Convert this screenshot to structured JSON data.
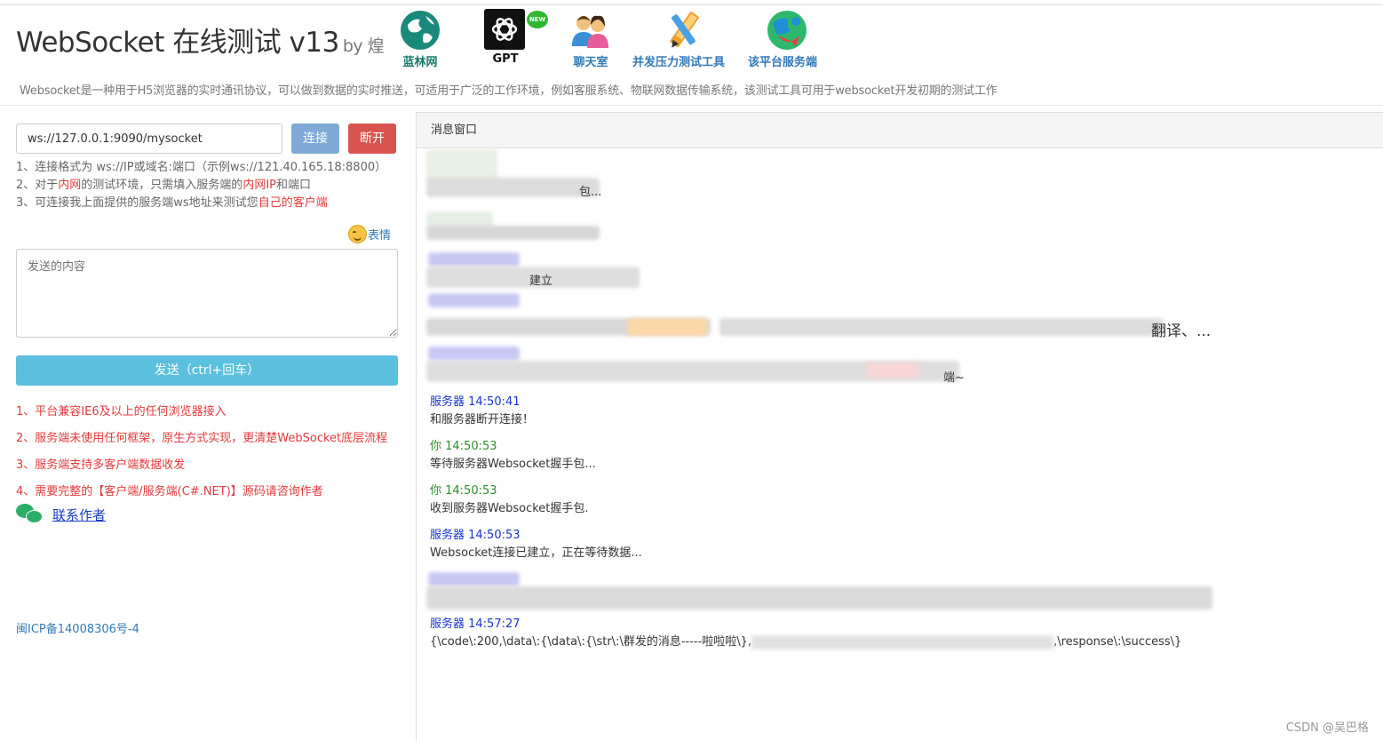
{
  "header": {
    "title": "WebSocket 在线测试 v13",
    "byline": "by 煌",
    "intro": "Websocket是一种用于H5浏览器的实时通讯协议，可以做到数据的实时推送，可适用于广泛的工作环境，例如客服系统、物联网数据传输系统，该测试工具可用于websocket开发初期的测试工作"
  },
  "nav": [
    {
      "label": "蓝林网",
      "icon": "globe-icon",
      "color": "#1a7a6e"
    },
    {
      "label": "GPT",
      "icon": "openai-icon",
      "badge": "NEW",
      "color": "#111111"
    },
    {
      "label": "聊天室",
      "icon": "chat-users-icon",
      "color": "#337ab7"
    },
    {
      "label": "并发压力测试工具",
      "icon": "tools-icon",
      "color": "#337ab7"
    },
    {
      "label": "该平台服务端",
      "icon": "server-globe-icon",
      "color": "#337ab7"
    }
  ],
  "connect": {
    "url": "ws://127.0.0.1:9090/mysocket",
    "connect_label": "连接",
    "disconnect_label": "断开"
  },
  "tips": {
    "line1": "1、连接格式为 ws://IP或域名:端口（示例ws://121.40.165.18:8800）",
    "line2_a": "2、对于",
    "line2_b": "内网",
    "line2_c": "的测试环境，只需填入服务端的",
    "line2_d": "内网IP",
    "line2_e": "和端口",
    "line3_a": "3、可连接我上面提供的服务端ws地址来测试您",
    "line3_b": "自己的客户端"
  },
  "emoji_label": "表情",
  "send": {
    "placeholder": "发送的内容",
    "button_label": "发送（ctrl+回车）"
  },
  "features": [
    "1、平台兼容IE6及以上的任何浏览器接入",
    "2、服务端未使用任何框架，原生方式实现，更清楚WebSocket底层流程",
    "3、服务端支持多客户端数据收发",
    "4、需要完整的【客户端/服务端(C#.NET)】源码请咨询作者"
  ],
  "contact_label": "联系作者",
  "icp": "闽ICP备14008306号-4",
  "panel_title": "消息窗口",
  "messages": [
    {
      "who": "服务器 14:50:41",
      "type": "server",
      "body": "和服务器断开连接！"
    },
    {
      "who": "你 14:50:53",
      "type": "you",
      "body": "等待服务器Websocket握手包..."
    },
    {
      "who": "你 14:50:53",
      "type": "you",
      "body": "收到服务器Websocket握手包."
    },
    {
      "who": "服务器 14:50:53",
      "type": "server",
      "body": "Websocket连接已建立，正在等待数据..."
    },
    {
      "who": "服务器 14:57:27",
      "type": "server",
      "body": "{\\code\\:200,\\data\\:{\\data\\:{\\str\\:\\群发的消息-----啦啦啦\\},",
      "body_tail": ",\\response\\:\\success\\}"
    }
  ],
  "blurred_fragments": {
    "frag1": "包...",
    "frag2": "建立",
    "frag3": "翻译、...",
    "frag4": "端~"
  },
  "watermark": "CSDN @吴巴格"
}
